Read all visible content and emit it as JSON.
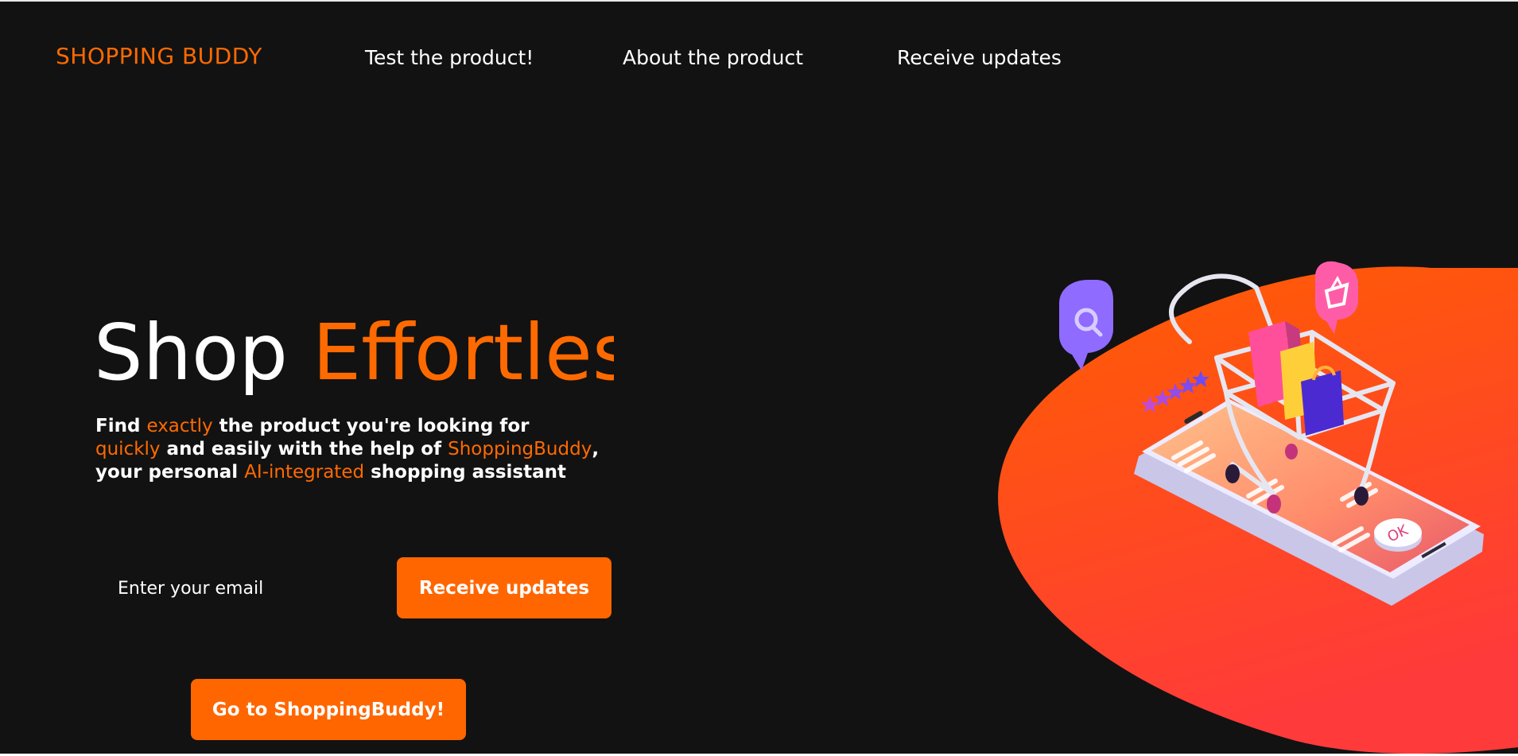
{
  "brand": {
    "name": "SHOPPING BUDDY"
  },
  "nav": {
    "links": [
      {
        "label": "Test the product!"
      },
      {
        "label": "About the product"
      },
      {
        "label": "Receive updates"
      }
    ]
  },
  "hero": {
    "title_part1": "Shop ",
    "title_part2": "Effortles",
    "description": {
      "l1_a": "Find ",
      "l1_b": "exactly",
      "l1_c": " the product you're looking for",
      "l2_a": "quickly",
      "l2_b": " and easily with the help of ",
      "l2_c": "ShoppingBuddy",
      "l2_d": ",",
      "l3_a": "your personal ",
      "l3_b": "AI-integrated",
      "l3_c": " shopping assistant"
    },
    "email_placeholder": "Enter your email",
    "subscribe_label": "Receive updates",
    "cta_label": "Go to ShoppingBuddy!",
    "illustration_badge": "OK"
  },
  "colors": {
    "background": "#121212",
    "accent": "#ff6a00",
    "text": "#ffffff",
    "blob_gradient": [
      "#ff5a00",
      "#ff3a38"
    ]
  },
  "icons": [
    "shopping-cart-illustration",
    "search-bubble-icon",
    "basket-bubble-icon",
    "smartphone-illustration",
    "rating-stars-icon"
  ]
}
